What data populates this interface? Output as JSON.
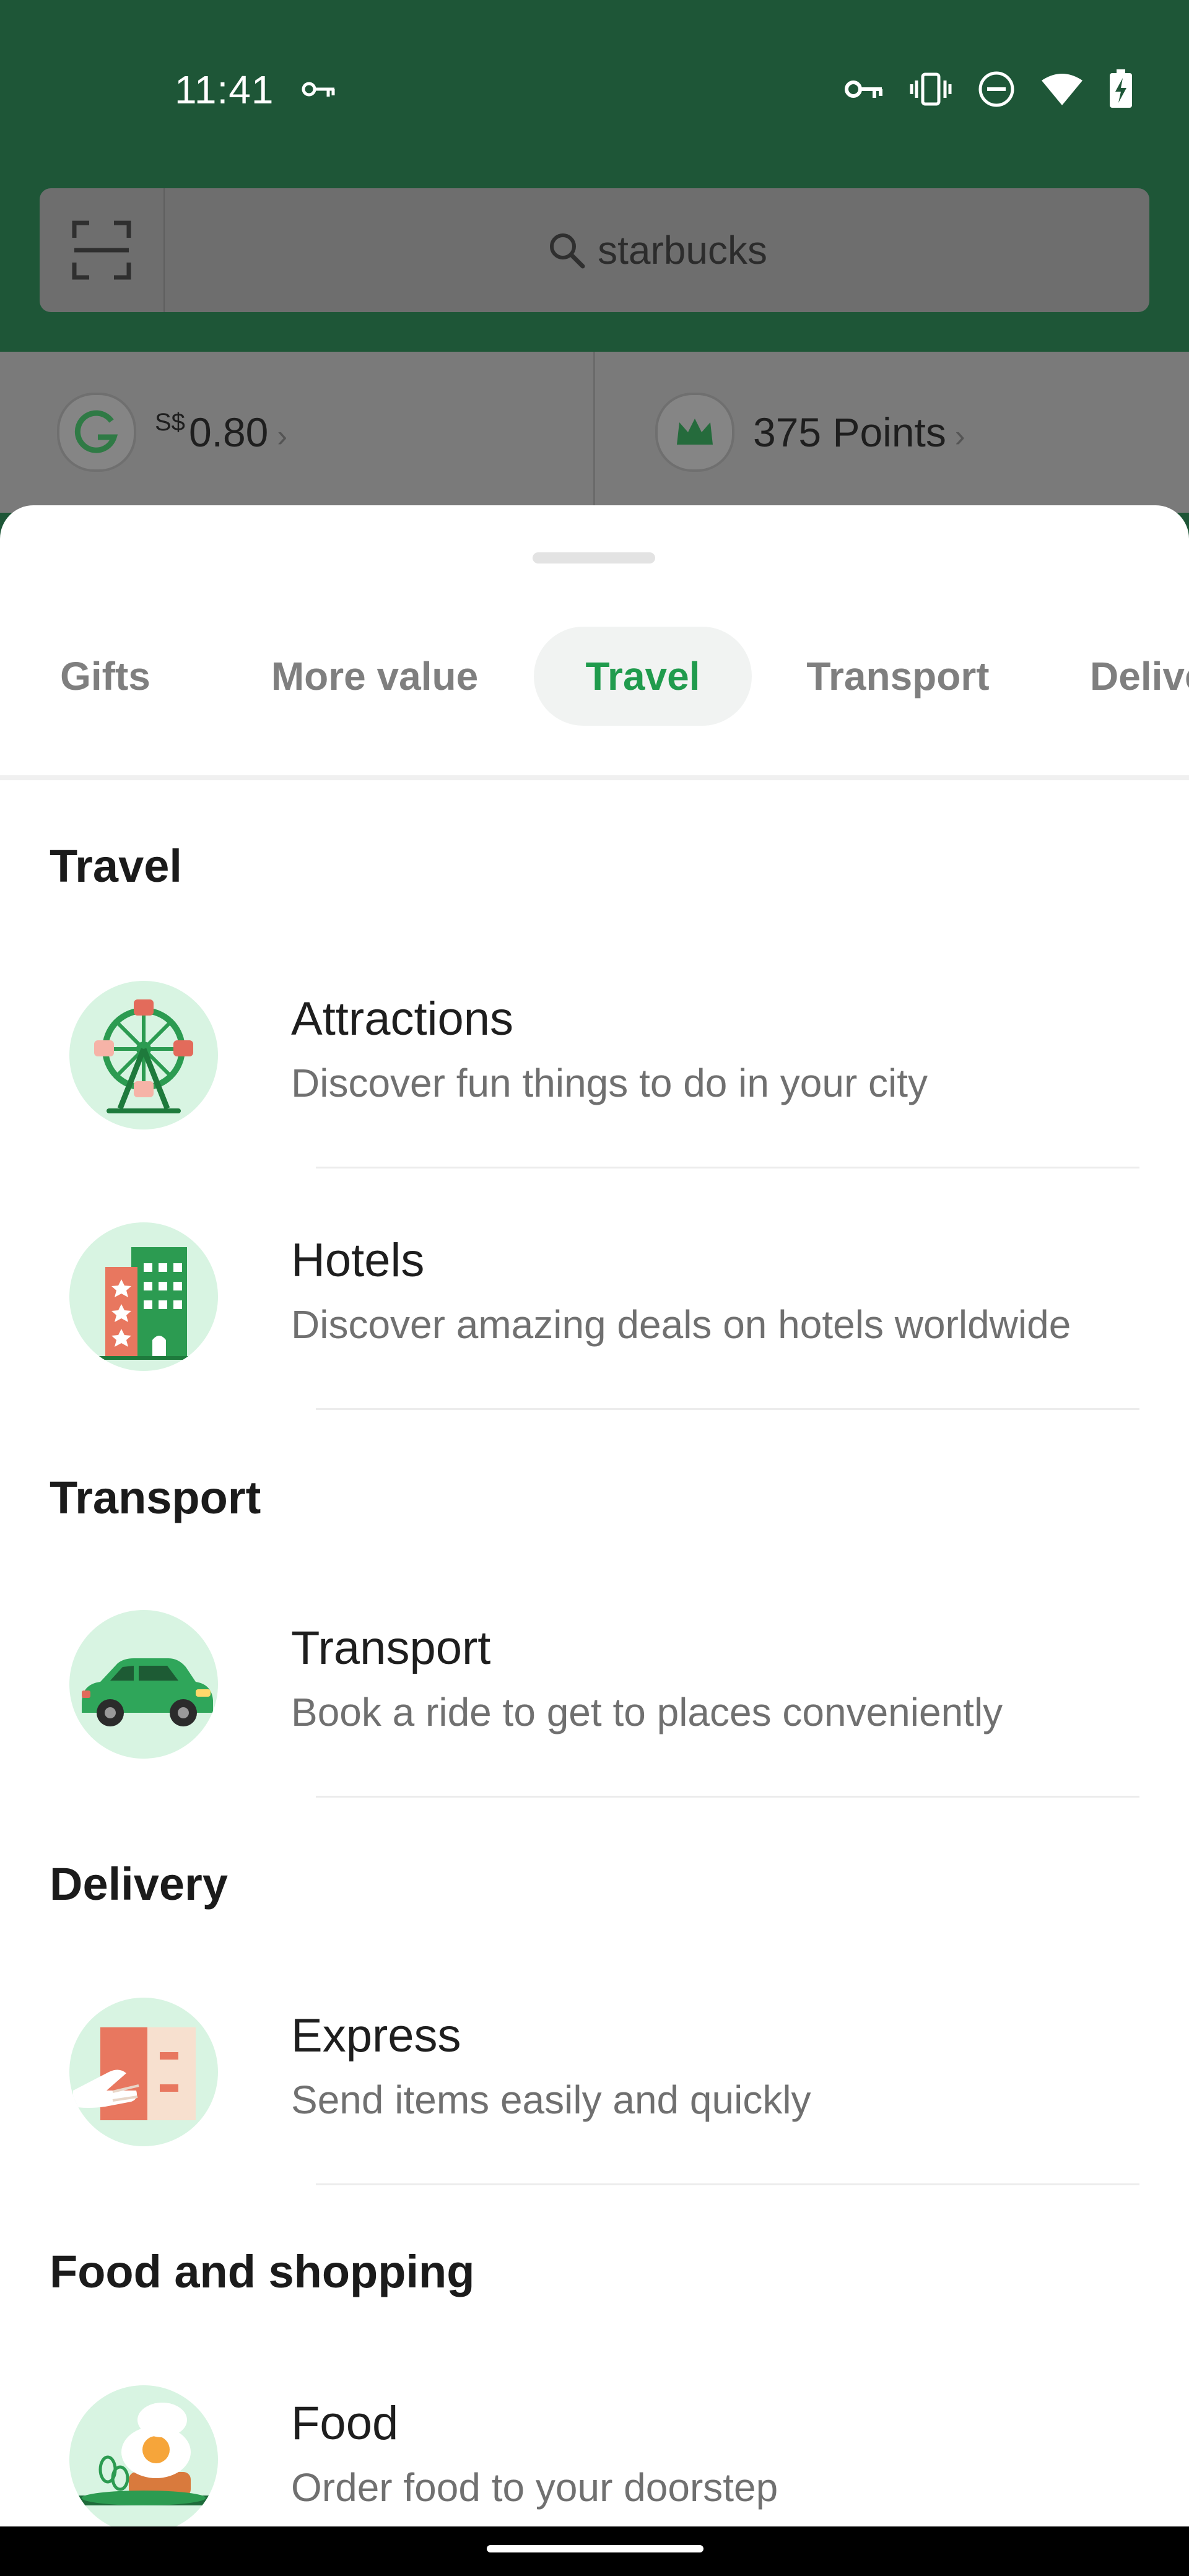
{
  "status_bar": {
    "time": "11:41",
    "left_icons": [
      "vpn-key-icon"
    ],
    "right_icons": [
      "vpn-key-icon",
      "vibrate-icon",
      "do-not-disturb-icon",
      "wifi-icon",
      "battery-charging-icon"
    ]
  },
  "search": {
    "placeholder": "starbucks",
    "scan_icon": "scan-icon",
    "search_icon": "search-icon"
  },
  "wallet": {
    "balance_prefix": "S$",
    "balance": "0.80",
    "points": "375 Points"
  },
  "tabs": [
    {
      "label": "Gifts",
      "active": false
    },
    {
      "label": "More value",
      "active": false
    },
    {
      "label": "Travel",
      "active": true
    },
    {
      "label": "Transport",
      "active": false
    },
    {
      "label": "Delivery",
      "active": false
    }
  ],
  "sections": [
    {
      "title": "Travel",
      "items": [
        {
          "title": "Attractions",
          "subtitle": "Discover fun things to do in your city",
          "icon": "ferris-wheel-icon"
        },
        {
          "title": "Hotels",
          "subtitle": "Discover amazing deals on hotels worldwide",
          "icon": "hotel-icon"
        }
      ]
    },
    {
      "title": "Transport",
      "items": [
        {
          "title": "Transport",
          "subtitle": "Book a ride to get to places conveniently",
          "icon": "car-icon"
        }
      ]
    },
    {
      "title": "Delivery",
      "items": [
        {
          "title": "Express",
          "subtitle": "Send items easily and quickly",
          "icon": "parcel-icon"
        }
      ]
    },
    {
      "title": "Food and shopping",
      "items": [
        {
          "title": "Food",
          "subtitle": "Order food to your doorstep",
          "icon": "food-icon"
        }
      ]
    }
  ],
  "colors": {
    "header": "#1e5637",
    "accent": "#209b4d",
    "icon_bg": "#d8f4e2"
  }
}
